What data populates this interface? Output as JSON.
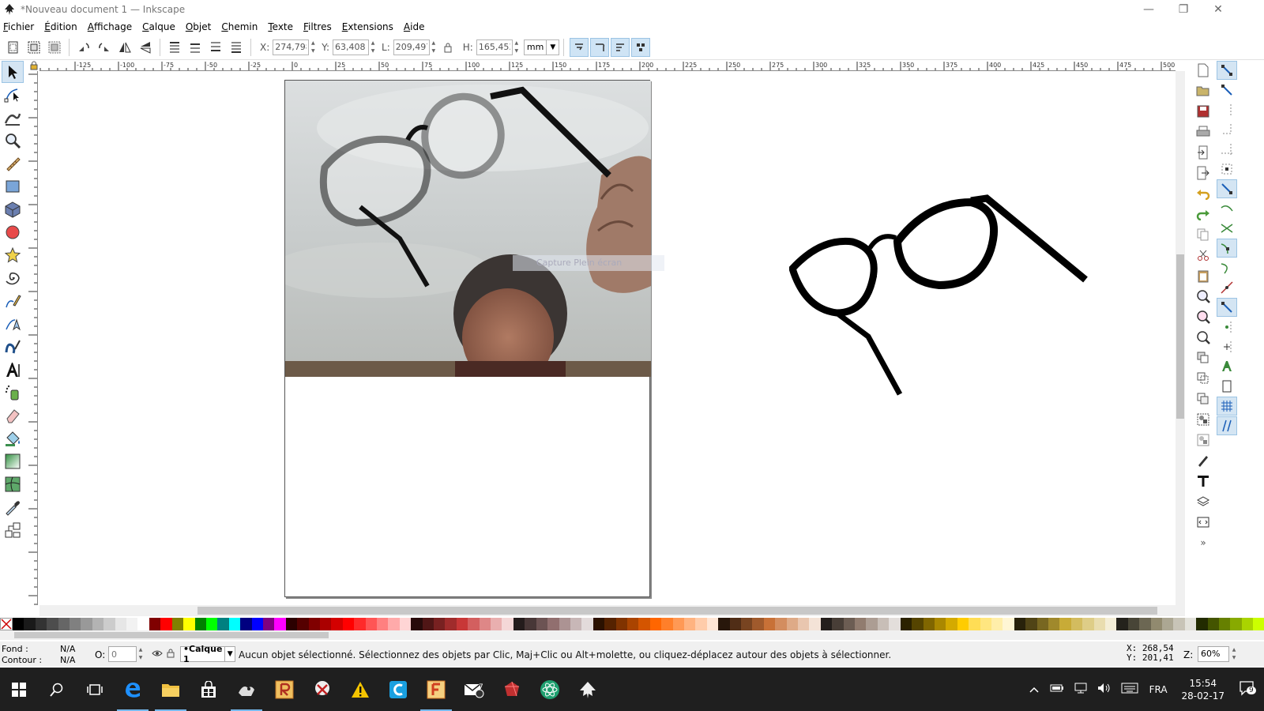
{
  "window": {
    "title": "*Nouveau document 1 — Inkscape",
    "minimize": "—",
    "maximize": "❐",
    "close": "✕"
  },
  "menu": [
    "Fichier",
    "Édition",
    "Affichage",
    "Calque",
    "Objet",
    "Chemin",
    "Texte",
    "Filtres",
    "Extensions",
    "Aide"
  ],
  "controls": {
    "x_label": "X:",
    "x_value": "274,798",
    "y_label": "Y:",
    "y_value": "63,408",
    "w_label": "L:",
    "w_value": "209,497",
    "h_label": "H:",
    "h_value": "165,453",
    "unit": "mm"
  },
  "tools": [
    "selector-tool-icon",
    "node-tool-icon",
    "tweak-tool-icon",
    "zoom-tool-icon",
    "measure-tool-icon",
    "rectangle-tool-icon",
    "box3d-tool-icon",
    "ellipse-tool-icon",
    "star-tool-icon",
    "spiral-tool-icon",
    "pencil-tool-icon",
    "pen-tool-icon",
    "calligraphy-tool-icon",
    "text-tool-icon",
    "spray-tool-icon",
    "eraser-tool-icon",
    "paint-bucket-tool-icon",
    "gradient-tool-icon",
    "mesh-tool-icon",
    "dropper-tool-icon",
    "connector-tool-icon"
  ],
  "ruler": {
    "top_ticks": [
      "-125",
      "-100",
      "-75",
      "-50",
      "-25",
      "0",
      "25",
      "50",
      "75",
      "100",
      "125",
      "150",
      "175",
      "200",
      "225",
      "250",
      "275",
      "300",
      "325",
      "350",
      "375",
      "400",
      "425",
      "450",
      "475",
      "500"
    ]
  },
  "canvas": {
    "ghost_tooltip": "Capture Plein écran"
  },
  "palette": {
    "colors": [
      "#000000",
      "#1a1a1a",
      "#333333",
      "#4d4d4d",
      "#666666",
      "#808080",
      "#999999",
      "#b3b3b3",
      "#cccccc",
      "#e6e6e6",
      "#f2f2f2",
      "#ffffff",
      "#800000",
      "#ff0000",
      "#808000",
      "#ffff00",
      "#008000",
      "#00ff00",
      "#008080",
      "#00ffff",
      "#000080",
      "#0000ff",
      "#800080",
      "#ff00ff",
      "#2b0000",
      "#550000",
      "#800000",
      "#aa0000",
      "#d40000",
      "#ff0000",
      "#ff2a2a",
      "#ff5555",
      "#ff8080",
      "#ffaaaa",
      "#ffd5d5",
      "#280b0b",
      "#501616",
      "#782121",
      "#a02c2c",
      "#c83737",
      "#d35f5f",
      "#de8787",
      "#e9afaf",
      "#f4d7d7",
      "#241c1c",
      "#483737",
      "#6c5353",
      "#916f6f",
      "#ac9393",
      "#c8b7b7",
      "#e3dbdb",
      "#2b1100",
      "#552200",
      "#803300",
      "#aa4400",
      "#d45500",
      "#ff6600",
      "#ff7f2a",
      "#ff9955",
      "#ffb380",
      "#ffccaa",
      "#ffe6d5",
      "#28170b",
      "#502d16",
      "#784421",
      "#a05a2c",
      "#c87137",
      "#d38d5f",
      "#deaa87",
      "#e9c6af",
      "#f4e3d7",
      "#241f1c",
      "#483e37",
      "#6c5d53",
      "#917c6f",
      "#ac9d93",
      "#c8beb7",
      "#e3dedb",
      "#2b2200",
      "#554400",
      "#806600",
      "#aa8800",
      "#d4aa00",
      "#ffcc00",
      "#ffdd55",
      "#ffe680",
      "#ffeeaa",
      "#fff6d5",
      "#28220b",
      "#504416",
      "#786721",
      "#a0892c",
      "#c8ab37",
      "#d3bc5f",
      "#decd87",
      "#e9ddaf",
      "#f4eed7",
      "#24221c",
      "#484537",
      "#6c6753",
      "#918a6f",
      "#aca793",
      "#c8c4b7",
      "#e3e2db",
      "#222b00",
      "#445500",
      "#668000",
      "#88aa00",
      "#aad400",
      "#ccff00"
    ]
  },
  "status": {
    "fill_label": "Fond :",
    "fill_value": "N/A",
    "stroke_label": "Contour :",
    "stroke_value": "N/A",
    "opacity_label": "O:",
    "opacity_value": "0",
    "layer": "•Calque 1",
    "message": "Aucun objet sélectionné. Sélectionnez des objets par Clic, Maj+Clic ou Alt+molette, ou cliquez-déplacez autour des objets à sélectionner.",
    "coord_x": "X: 268,54",
    "coord_y": "Y: 201,41",
    "zoom_label": "Z:",
    "zoom_value": "60%"
  },
  "taskbar": {
    "language": "FRA",
    "time": "15:54",
    "date": "28-02-17",
    "notifications": "9",
    "mail_badge": "7"
  }
}
